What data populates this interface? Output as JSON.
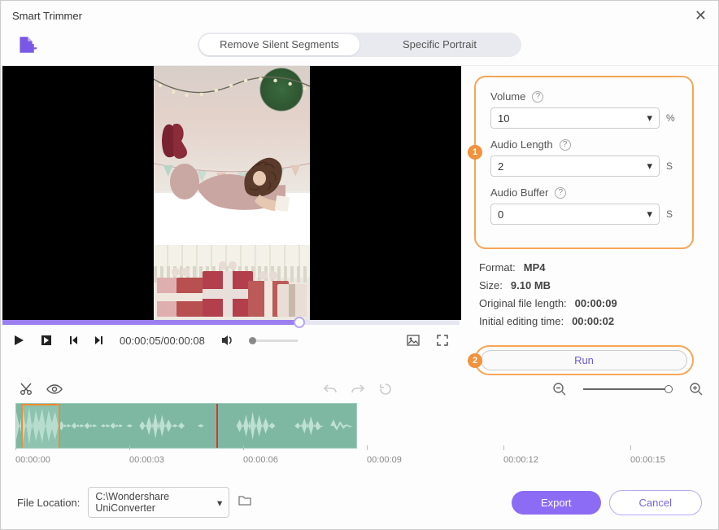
{
  "window": {
    "title": "Smart Trimmer"
  },
  "tabs": {
    "remove_silent": "Remove Silent Segments",
    "specific_portrait": "Specific Portrait"
  },
  "player": {
    "current_time": "00:00:05",
    "duration": "00:00:08",
    "time_display": "00:00:05/00:00:08"
  },
  "settings": {
    "volume_label": "Volume",
    "volume_value": "10",
    "volume_unit": "%",
    "audio_length_label": "Audio Length",
    "audio_length_value": "2",
    "audio_length_unit": "S",
    "audio_buffer_label": "Audio Buffer",
    "audio_buffer_value": "0",
    "audio_buffer_unit": "S"
  },
  "info": {
    "format_label": "Format:",
    "format_value": "MP4",
    "size_label": "Size:",
    "size_value": "9.10 MB",
    "orig_len_label": "Original file length:",
    "orig_len_value": "00:00:09",
    "edit_time_label": "Initial editing time:",
    "edit_time_value": "00:00:02"
  },
  "badges": {
    "one": "1",
    "two": "2"
  },
  "buttons": {
    "run": "Run",
    "export": "Export",
    "cancel": "Cancel"
  },
  "timeline": {
    "ticks": [
      "00:00:00",
      "00:00:03",
      "00:00:06",
      "00:00:09",
      "00:00:12",
      "00:00:15"
    ]
  },
  "footer": {
    "location_label": "File Location:",
    "location_value": "C:\\Wondershare UniConverter"
  }
}
